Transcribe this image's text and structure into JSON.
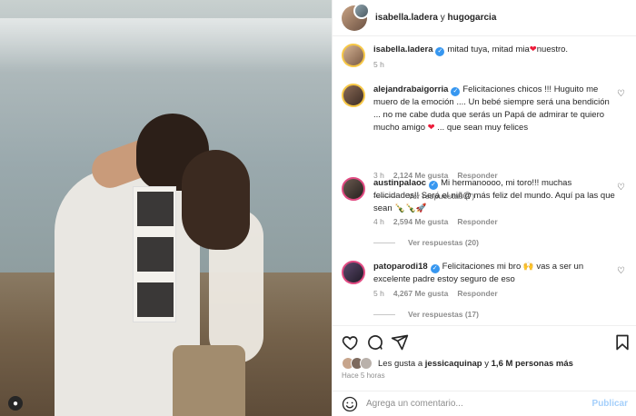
{
  "header": {
    "user1": "isabella.ladera",
    "connector": "y",
    "user2": "hugogarcia"
  },
  "caption": {
    "user": "isabella.ladera",
    "text_before": "mitad tuya, mitad mia",
    "heart": "❤",
    "text_after": "nuestro.",
    "time": "5 h"
  },
  "comments": [
    {
      "user": "alejandrabaigorria",
      "text": "Felicitaciones chicos !!! Huguito me muero de la emoción .... Un bebé siempre será una bendición ... no me cabe duda que serás un Papá de admirar te quiero mucho amigo",
      "heart": "❤",
      "text_after": "... que sean muy felices",
      "time": "3 h",
      "likes": "2,124 Me gusta",
      "reply": "Responder",
      "view_replies": "Ver respuestas (7)"
    },
    {
      "user": "austinpalaoc",
      "text": "Mi hermanoooo, mi toro!!! muchas felicidades!! Será el niñ@ más feliz del mundo. Aquí pa las que sean 🍾🍾🚀",
      "time": "4 h",
      "likes": "2,594 Me gusta",
      "reply": "Responder",
      "view_replies": "Ver respuestas (20)"
    },
    {
      "user": "patoparodi18",
      "text": "Felicitaciones mi bro 🙌 vas a ser un excelente padre estoy seguro de eso",
      "time": "5 h",
      "likes": "4,267 Me gusta",
      "reply": "Responder",
      "view_replies": "Ver respuestas (17)"
    }
  ],
  "likes": {
    "prefix": "Les gusta a",
    "user": "jessicaquinap",
    "middle": "y",
    "others": "1,6 M personas más"
  },
  "posted": "Hace 5 horas",
  "add_comment": {
    "placeholder": "Agrega un comentario...",
    "publish": "Publicar"
  },
  "icons": {
    "like": "heart-icon",
    "comment": "comment-icon",
    "share": "share-icon",
    "save": "bookmark-icon",
    "emoji": "smiley-icon",
    "verified": "verified-badge-icon"
  },
  "colors": {
    "verified": "#3797f0",
    "heart": "#ed1c3a",
    "publish": "#a4cffb",
    "muted": "#8e8e8e"
  }
}
